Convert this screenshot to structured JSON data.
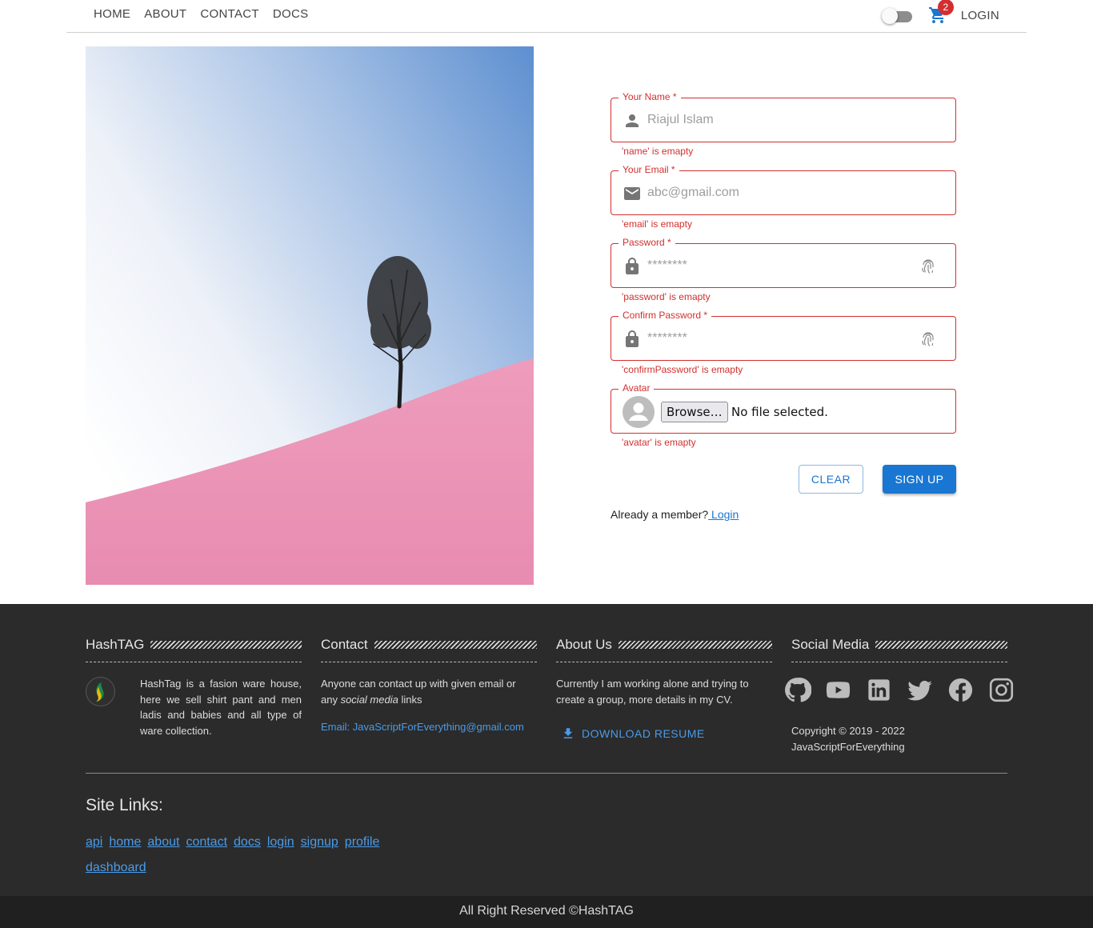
{
  "nav": {
    "links": [
      "Home",
      "About",
      "Contact",
      "Docs"
    ],
    "cart_count": "2",
    "login": "Login"
  },
  "form": {
    "name_label": "Your Name *",
    "name_placeholder": "Riajul Islam",
    "name_error": "'name' is emapty",
    "email_label": "Your Email *",
    "email_placeholder": "abc@gmail.com",
    "email_error": "'email' is emapty",
    "password_label": "Password *",
    "password_placeholder": "********",
    "password_error": "'password' is emapty",
    "confirm_label": "Confirm Password *",
    "confirm_placeholder": "********",
    "confirm_error": "'confirmPassword' is emapty",
    "avatar_label": "Avatar",
    "browse_label": "Browse…",
    "file_status": "No file selected.",
    "avatar_error": "'avatar' is emapty",
    "clear_label": "Clear",
    "signup_label": "Sign Up",
    "member_text": "Already a member?",
    "member_link": " Login"
  },
  "footer": {
    "hashtag_title": "HashTAG",
    "hashtag_text": "HashTag is a fasion ware house, here we sell shirt pant and men ladis and babies and all type of ware collection.",
    "contact_title": "Contact",
    "contact_text_1": "Anyone can contact up with given email or any ",
    "contact_text_em": "social media",
    "contact_text_2": " links",
    "contact_email": "Email: JavaScriptForEverything@gmail.com",
    "about_title": "About Us",
    "about_text": "Currently I am working alone and trying to create a group, more details in my CV.",
    "resume_label": "Download Resume",
    "social_title": "Social Media",
    "social_icons": [
      "github-icon",
      "youtube-icon",
      "linkedin-icon",
      "twitter-icon",
      "facebook-icon",
      "instagram-icon"
    ],
    "copyright_1": "Copyright © 2019 - 2022",
    "copyright_2": "JavaScriptForEverything",
    "site_title": "Site Links:",
    "site_links": [
      "api",
      "home",
      "about",
      "contact",
      "docs",
      "login",
      "signup",
      "profile",
      "dashboard"
    ],
    "bottom": "All Right Reserved ©HashTAG"
  },
  "colors": {
    "primary": "#1976d2",
    "error": "#d32f2f",
    "footer_bg": "#2b2b2b",
    "link": "#4a9be8"
  }
}
